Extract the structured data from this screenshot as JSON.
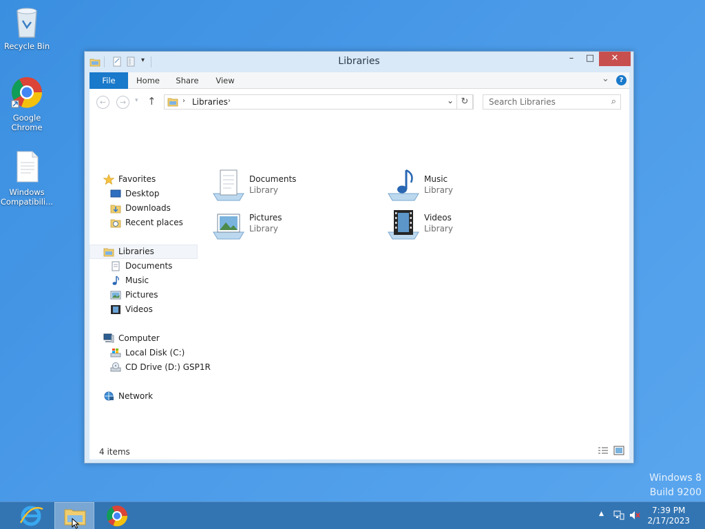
{
  "desktop": {
    "icons": [
      {
        "label": "Recycle Bin",
        "icon": "recycle-bin-icon"
      },
      {
        "label": "Google Chrome",
        "icon": "chrome-icon"
      },
      {
        "label": "Windows Compatibili...",
        "icon": "document-icon"
      }
    ],
    "watermark": {
      "line1": "Windows 8",
      "line2": "Build 9200"
    }
  },
  "window": {
    "title": "Libraries",
    "controls": {
      "minimize": "–",
      "maximize": "□",
      "close": "✕"
    },
    "ribbon": {
      "tabs": [
        "File",
        "Home",
        "Share",
        "View"
      ],
      "expand": "⌄",
      "help": "?"
    },
    "address": {
      "path": "Libraries",
      "separator": "›",
      "dropdown": "⌄",
      "refresh": "↻"
    },
    "search": {
      "placeholder": "Search Libraries"
    },
    "nav": {
      "favorites": {
        "label": "Favorites",
        "items": [
          "Desktop",
          "Downloads",
          "Recent places"
        ]
      },
      "libraries": {
        "label": "Libraries",
        "items": [
          "Documents",
          "Music",
          "Pictures",
          "Videos"
        ]
      },
      "computer": {
        "label": "Computer",
        "items": [
          "Local Disk (C:)",
          "CD Drive (D:) GSP1R"
        ]
      },
      "network": {
        "label": "Network"
      }
    },
    "content": {
      "items": [
        {
          "name": "Documents",
          "type": "Library"
        },
        {
          "name": "Music",
          "type": "Library"
        },
        {
          "name": "Pictures",
          "type": "Library"
        },
        {
          "name": "Videos",
          "type": "Library"
        }
      ]
    },
    "status": "4 items"
  },
  "taskbar": {
    "apps": [
      "internet-explorer-icon",
      "file-explorer-icon",
      "chrome-icon"
    ],
    "clock": {
      "time": "7:39 PM",
      "date": "2/17/2023"
    },
    "tray": {
      "chevron": "▲"
    }
  },
  "colors": {
    "accent": "#1979ca",
    "close": "#c7504f",
    "taskbar": "#3375b3"
  }
}
